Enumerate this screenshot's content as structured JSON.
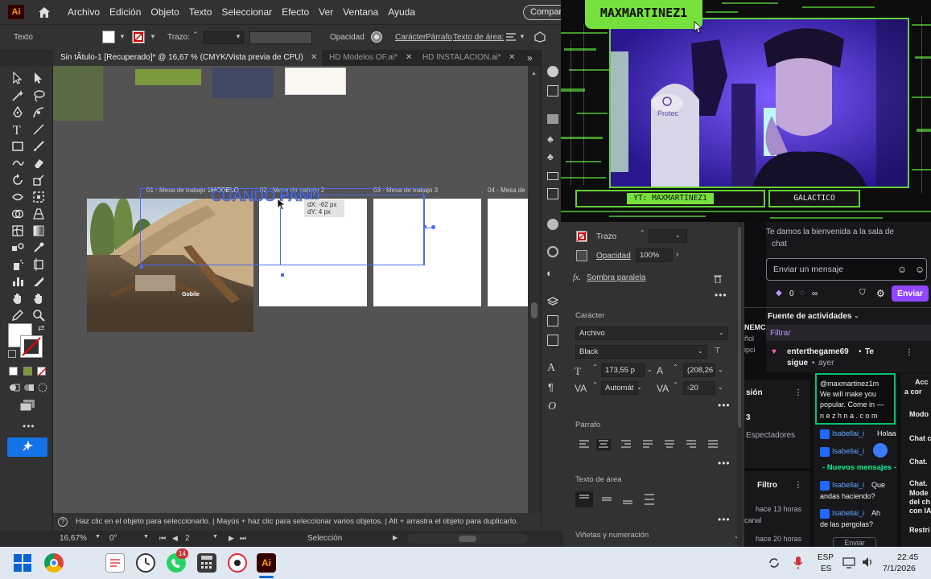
{
  "menubar": {
    "app_logo": "Ai",
    "menus": [
      "Archivo",
      "Edición",
      "Objeto",
      "Texto",
      "Seleccionar",
      "Efecto",
      "Ver",
      "Ventana",
      "Ayuda"
    ],
    "share_label": "Compart"
  },
  "controlbar": {
    "context_label": "Texto",
    "stroke_label": "Trazo:",
    "opacity_label": "Opacidad",
    "character_label": "Carácter",
    "paragraph_label": "Párrafo",
    "area_text_label": "Texto de área:"
  },
  "tabs": [
    {
      "label": "Sin tÃtulo-1 [Recuperado]* @ 16,67 % (CMYK/Vista previa de CPU)",
      "close": "✕"
    },
    {
      "label": "HD Modelos OF.ai*",
      "close": "✕"
    },
    {
      "label": "HD INSTALACION.ai*",
      "close": "✕"
    }
  ],
  "tabs_overflow": "»",
  "canvas": {
    "artboard_labels": [
      "01 - Mesa de trabajo 1",
      "02 - Mesa de trabajo 2",
      "03 - Mesa de trabajo 3",
      "04 - Mesa de"
    ],
    "modelo_label": "MODELO",
    "headline_text": "CUANDO PAND",
    "tooltip_dx": "dX: -62 px",
    "tooltip_dy": "dY: 4 px",
    "photo_logo": "Gobile"
  },
  "hint": "Haz clic en el objeto para seleccionarlo.  |  Mayús + haz clic para seleccionar varios objetos.  |  Alt + arrastra el objeto para duplicarlo.",
  "statusbar": {
    "zoom": "16,67%",
    "angle": "0°",
    "artboard_num": "2",
    "mode": "Selección"
  },
  "props": {
    "stroke_label": "Trazo",
    "opacity_label": "Opacidad",
    "opacity_value": "100%",
    "fx_label": "Sombra paralela",
    "character_title": "Carácter",
    "font_family": "Archivo",
    "font_style": "Black",
    "font_size": "173,55 p",
    "leading": "(208,26",
    "kerning": "Automát",
    "tracking": "-20",
    "paragraph_title": "Párrafo",
    "area_text_title": "Texto de área",
    "bullets_title": "Viñetas y numeración"
  },
  "stream": {
    "streamer_name": "MAXMARTINEZ1",
    "yt_badge": "YT: MAXMARTINEZ1",
    "galactico_badge": "GALACTICO",
    "mic_brand": "Protec"
  },
  "chat": {
    "welcome": [
      "Te damos la bienvenida a la sala de",
      "chat"
    ],
    "input_placeholder": "Enviar un mensaje",
    "points": "0",
    "infinity": "∞",
    "send_label": "Enviar",
    "activity_title": "Fuente de actividades",
    "filter_label": "Filtrar",
    "follow_user": "enterthegame69",
    "follow_text": "Te",
    "follow_text2": "sigue",
    "follow_time": "ayer",
    "left_fragments": [
      "NEMC",
      "ñol",
      "ipci",
      "sión",
      "3",
      "Espectadores",
      "Filtro",
      "hace 13 horas",
      "canal",
      "hace 20 horas"
    ],
    "promo_lines": [
      "@maxmartinez1m",
      "We will make you",
      "popular. Come in —",
      "n e z h n a . c o m"
    ],
    "messages": [
      {
        "user": "Isabellai_i",
        "text": "Holaa"
      },
      {
        "user": "Isabellai_i",
        "text": ""
      },
      {
        "user": "Isabellai_i",
        "text": "Que"
      },
      {
        "user": "Isabellai_i",
        "text": "Ah"
      }
    ],
    "new_messages": "- Nuevos mensajes -",
    "msg_continuations": [
      "andas haciendo?",
      "de las pergolas?"
    ],
    "right_fragments": [
      "Acc",
      "a cor",
      "Modo",
      "Chat c",
      "Chat.",
      "Chat.",
      "Mode",
      "del ch",
      "con IA",
      "Restri"
    ],
    "send_button_small": "Enviar"
  },
  "taskbar": {
    "lang": "ESP",
    "lang2": "ES",
    "time": "22:45",
    "date": "7/1/2026",
    "whatsapp_badge": "14"
  },
  "colors": {
    "accent_green": "#76e13c",
    "twitch_purple": "#9147ff",
    "ai_orange": "#ff9a00"
  }
}
